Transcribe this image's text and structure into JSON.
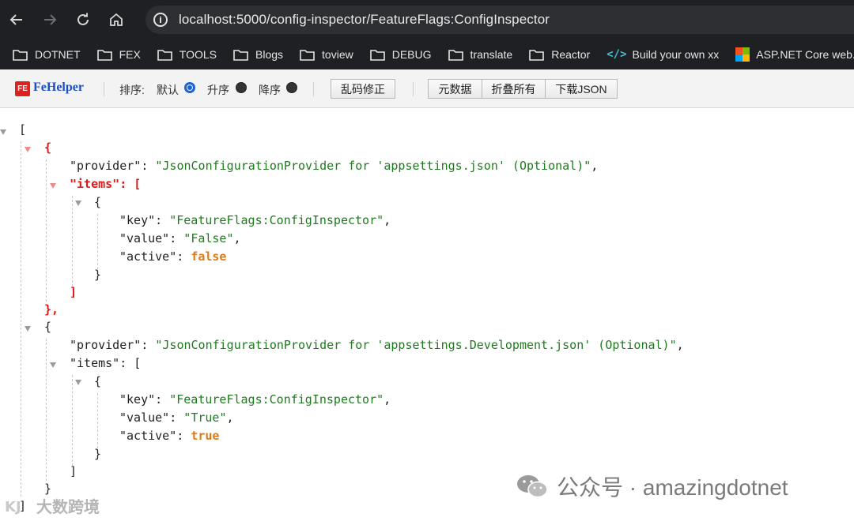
{
  "browser": {
    "url": "localhost:5000/config-inspector/FeatureFlags:ConfigInspector",
    "bookmarks": [
      {
        "label": "DOTNET",
        "icon": "folder-icon"
      },
      {
        "label": "FEX",
        "icon": "folder-icon"
      },
      {
        "label": "TOOLS",
        "icon": "folder-icon"
      },
      {
        "label": "Blogs",
        "icon": "folder-icon"
      },
      {
        "label": "toview",
        "icon": "folder-icon"
      },
      {
        "label": "DEBUG",
        "icon": "folder-icon"
      },
      {
        "label": "translate",
        "icon": "folder-icon"
      },
      {
        "label": "Reactor",
        "icon": "folder-icon"
      },
      {
        "label": "Build your own xx",
        "icon": "code-icon"
      },
      {
        "label": "ASP.NET Core web...",
        "icon": "microsoft-icon"
      }
    ]
  },
  "fehelper": {
    "logo_text": "FE",
    "name": "FeHelper",
    "sort_label": "排序:",
    "sort_default": "默认",
    "sort_asc": "升序",
    "sort_desc": "降序",
    "selected_sort": "默认",
    "fix_encoding": "乱码修正",
    "raw_data": "元数据",
    "collapse_all": "折叠所有",
    "download_json": "下载JSON"
  },
  "json": {
    "open_bracket": "[",
    "close_bracket": "]",
    "objects": [
      {
        "provider": "JsonConfigurationProvider for 'appsettings.json' (Optional)",
        "items": [
          {
            "key": "FeatureFlags:ConfigInspector",
            "value": "False",
            "active": "false"
          }
        ]
      },
      {
        "provider": "JsonConfigurationProvider for 'appsettings.Development.json' (Optional)",
        "items": [
          {
            "key": "FeatureFlags:ConfigInspector",
            "value": "True",
            "active": "true"
          }
        ]
      }
    ]
  },
  "watermark": {
    "channel": "公众号 · amazingdotnet",
    "source": "大数跨境"
  },
  "colors": {
    "chrome_bg": "#1f2023",
    "string": "#1f7a1f",
    "boolean": "#e07a16",
    "highlight": "#e01818",
    "brand": "#1a4fc2"
  }
}
